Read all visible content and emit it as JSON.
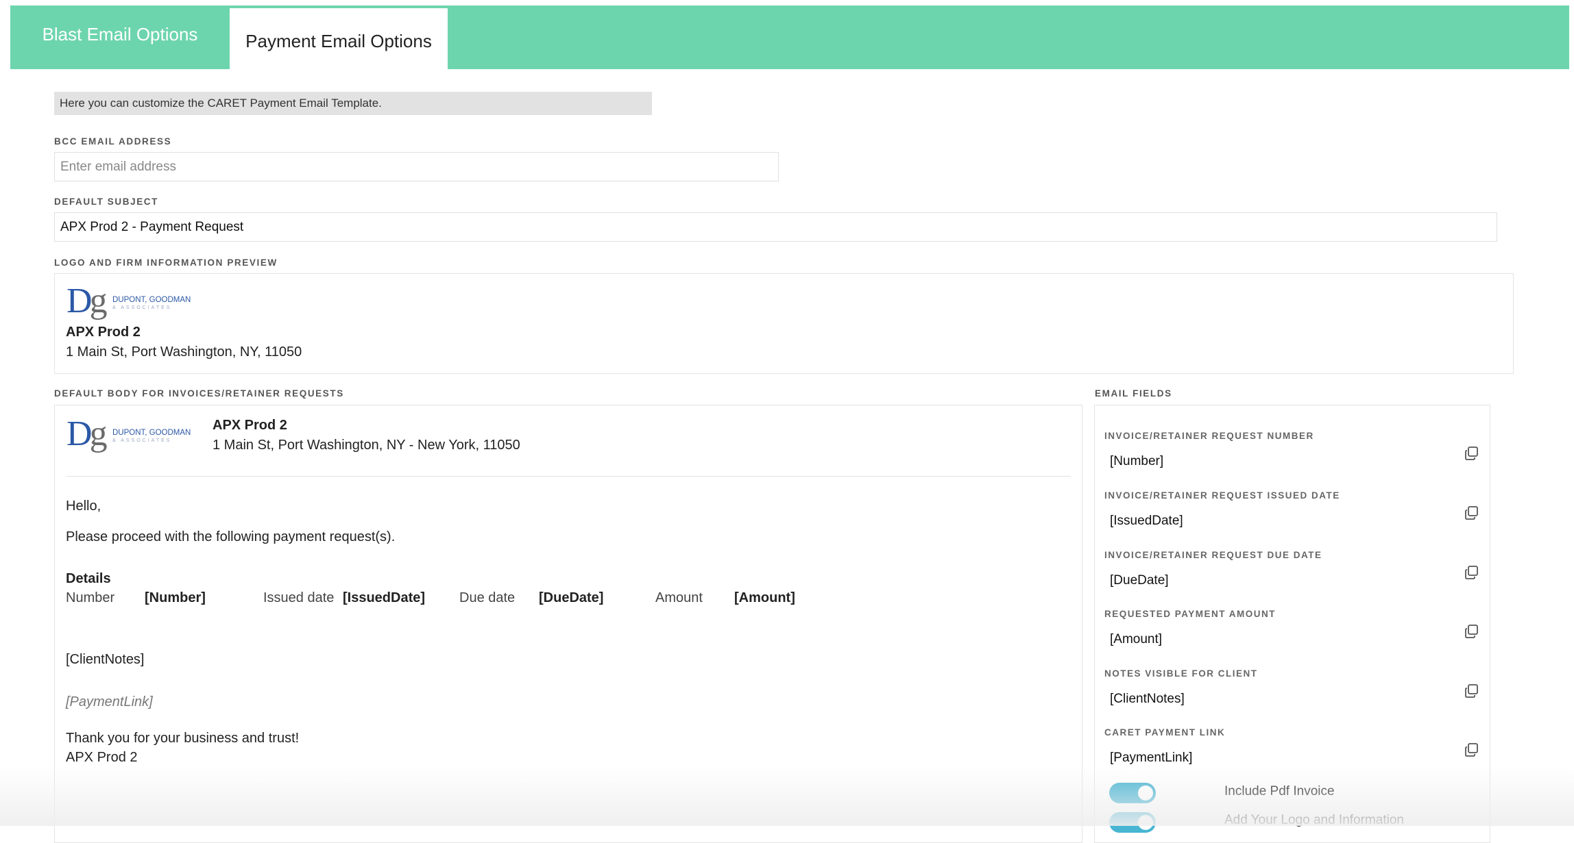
{
  "tabs": {
    "blast": "Blast Email Options",
    "payment": "Payment Email Options"
  },
  "banner": "Here you can customize the CARET Payment Email Template.",
  "bcc": {
    "label": "BCC EMAIL ADDRESS",
    "placeholder": "Enter email address",
    "value": ""
  },
  "subject": {
    "label": "DEFAULT SUBJECT",
    "value": "APX Prod 2 - Payment Request"
  },
  "logo": {
    "letters_d": "D",
    "letters_g": "g",
    "firm_name": "DUPONT, GOODMAN",
    "firm_sub": "& ASSOCIATES"
  },
  "preview": {
    "label": "LOGO AND FIRM INFORMATION PREVIEW",
    "firm": "APX Prod 2",
    "address": "1 Main St, Port Washington, NY, 11050"
  },
  "body": {
    "label": "DEFAULT BODY FOR INVOICES/RETAINER REQUESTS",
    "firm": "APX Prod 2",
    "address": "1 Main St, Port Washington, NY - New York, 11050",
    "greeting": "Hello,",
    "intro": "Please proceed with the following payment request(s).",
    "details_heading": "Details",
    "details": {
      "number_label": "Number",
      "number_value": "[Number]",
      "issued_label": "Issued date",
      "issued_value": "[IssuedDate]",
      "due_label": "Due date",
      "due_value": "[DueDate]",
      "amount_label": "Amount",
      "amount_value": "[Amount]"
    },
    "client_notes": "[ClientNotes]",
    "payment_link": "[PaymentLink]",
    "thanks": "Thank you for your business and trust!",
    "signature": "APX Prod 2"
  },
  "email_fields": {
    "label": "EMAIL FIELDS",
    "items": [
      {
        "label": "INVOICE/RETAINER REQUEST NUMBER",
        "value": "[Number]"
      },
      {
        "label": "INVOICE/RETAINER REQUEST ISSUED DATE",
        "value": "[IssuedDate]"
      },
      {
        "label": "INVOICE/RETAINER REQUEST DUE DATE",
        "value": "[DueDate]"
      },
      {
        "label": "REQUESTED PAYMENT AMOUNT",
        "value": "[Amount]"
      },
      {
        "label": "NOTES VISIBLE FOR CLIENT",
        "value": "[ClientNotes]"
      },
      {
        "label": "CARET PAYMENT LINK",
        "value": "[PaymentLink]"
      }
    ],
    "toggles": [
      {
        "label": "Include Pdf Invoice",
        "on": true
      },
      {
        "label": "Add Your Logo and Information",
        "on": true
      }
    ]
  },
  "colors": {
    "tab_bar": "#6dd5ad",
    "toggle_on": "#48b5d3",
    "logo_blue": "#2b58a6"
  }
}
